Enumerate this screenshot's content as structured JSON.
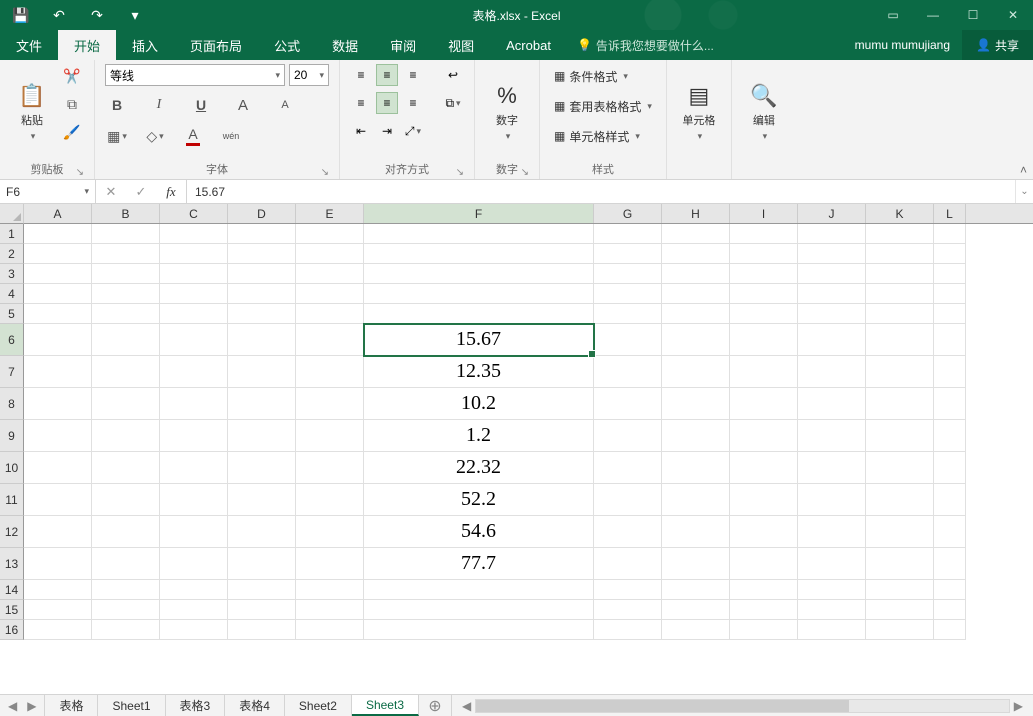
{
  "title": "表格.xlsx - Excel",
  "qat": {
    "save": "💾",
    "undo": "↶",
    "redo": "↷"
  },
  "window": {
    "ribbon_opts": "▭",
    "min": "—",
    "max": "☐",
    "close": "✕"
  },
  "menu": {
    "file": "文件",
    "home": "开始",
    "insert": "插入",
    "layout": "页面布局",
    "formulas": "公式",
    "data": "数据",
    "review": "审阅",
    "view": "视图",
    "acrobat": "Acrobat",
    "tellme": "告诉我您想要做什么...",
    "username": "mumu mumujiang",
    "share": "共享"
  },
  "ribbon": {
    "clipboard": {
      "paste": "粘贴",
      "label": "剪贴板"
    },
    "font": {
      "name": "等线",
      "size": "20",
      "label": "字体",
      "bold": "B",
      "italic": "I",
      "underline": "U",
      "ruby": "wén",
      "grow": "A",
      "shrink": "A"
    },
    "align": {
      "label": "对齐方式"
    },
    "number": {
      "btn": "数字",
      "label": "数字"
    },
    "styles": {
      "cond": "条件格式",
      "table": "套用表格格式",
      "cell": "单元格样式",
      "label": "样式"
    },
    "cells": {
      "btn": "单元格"
    },
    "editing": {
      "btn": "编辑"
    }
  },
  "namebox": "F6",
  "formula": "15.67",
  "columns": [
    "A",
    "B",
    "C",
    "D",
    "E",
    "F",
    "G",
    "H",
    "I",
    "J",
    "K",
    "L"
  ],
  "rows": [
    1,
    2,
    3,
    4,
    5,
    6,
    7,
    8,
    9,
    10,
    11,
    12,
    13,
    14,
    15,
    16
  ],
  "tall_rows": [
    6,
    7,
    8,
    9,
    10,
    11,
    12,
    13
  ],
  "data_cells": {
    "6": "15.67",
    "7": "12.35",
    "8": "10.2",
    "9": "1.2",
    "10": "22.32",
    "11": "52.2",
    "12": "54.6",
    "13": "77.7"
  },
  "active_col": "F",
  "active_row": 6,
  "sheets": [
    "表格",
    "Sheet1",
    "表格3",
    "表格4",
    "Sheet2",
    "Sheet3"
  ],
  "active_sheet": "Sheet3"
}
